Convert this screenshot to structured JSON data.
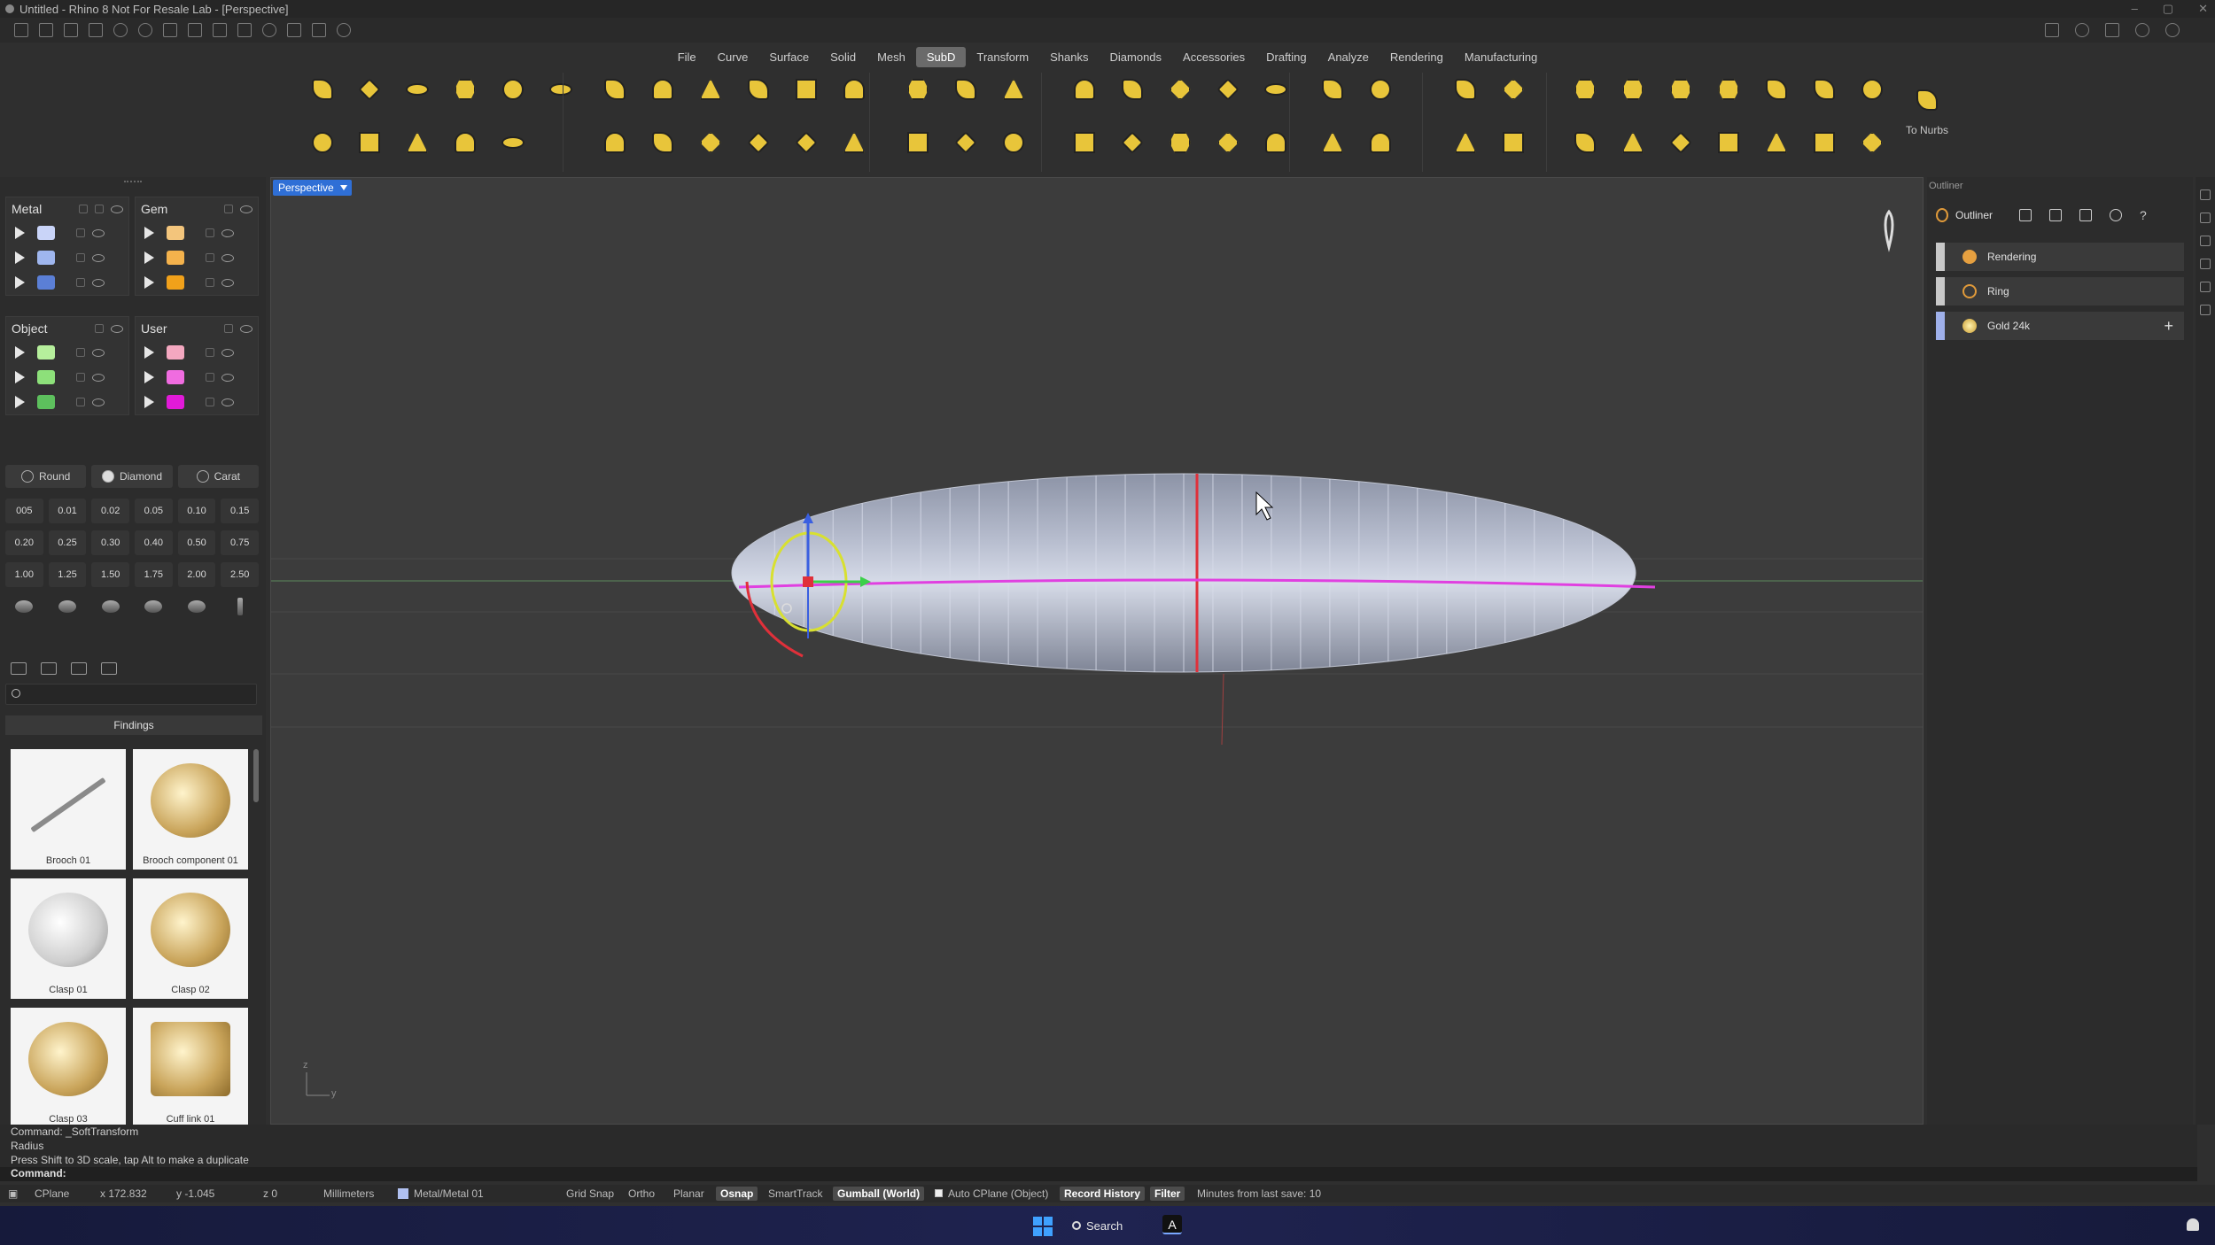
{
  "window": {
    "title": "Untitled - Rhino 8 Not For Resale Lab - [Perspective]"
  },
  "menu_tabs": [
    "File",
    "Curve",
    "Surface",
    "Solid",
    "Mesh",
    "SubD",
    "Transform",
    "Shanks",
    "Diamonds",
    "Accessories",
    "Drafting",
    "Analyze",
    "Rendering",
    "Manufacturing"
  ],
  "active_tab": "SubD",
  "toolbar": {
    "to_nurbs_label": "To Nurbs"
  },
  "layers": {
    "metal": {
      "title": "Metal",
      "colors": [
        "#c9d4f8",
        "#9fb6ee",
        "#5b7fd6"
      ]
    },
    "gem": {
      "title": "Gem",
      "colors": [
        "#f3c57c",
        "#f4b24c",
        "#f1a11a"
      ]
    },
    "object": {
      "title": "Object",
      "colors": [
        "#b6ef9c",
        "#8de07a",
        "#5dc05d"
      ]
    },
    "user": {
      "title": "User",
      "colors": [
        "#f4a8c0",
        "#f06ce0",
        "#e11ad8"
      ]
    }
  },
  "gem_panel": {
    "tabs": [
      "Round",
      "Diamond",
      "Carat"
    ],
    "sizes": [
      "005",
      "0.01",
      "0.02",
      "0.05",
      "0.10",
      "0.15",
      "0.20",
      "0.25",
      "0.30",
      "0.40",
      "0.50",
      "0.75",
      "1.00",
      "1.25",
      "1.50",
      "1.75",
      "2.00",
      "2.50"
    ]
  },
  "library": {
    "search_placeholder": "",
    "category": "Findings",
    "items": [
      "Brooch 01",
      "Brooch component 01",
      "Clasp 01",
      "Clasp 02",
      "Clasp 03",
      "Cuff link 01"
    ]
  },
  "viewport": {
    "name": "Perspective",
    "axis_z": "z",
    "axis_y": "y"
  },
  "outliner": {
    "panel_title": "Outliner",
    "header": "Outliner",
    "rows": [
      "Rendering",
      "Ring",
      "Gold 24k"
    ]
  },
  "command": {
    "lines": [
      "Command: _SoftTransform",
      "Radius",
      "Press Shift to 3D scale, tap Alt to make a duplicate"
    ],
    "prompt": "Command:"
  },
  "status": {
    "cplane": "CPlane",
    "x": "x 172.832",
    "y": "y -1.045",
    "z": "z 0",
    "units": "Millimeters",
    "layer": "Metal/Metal 01",
    "grid_snap": "Grid Snap",
    "ortho": "Ortho",
    "planar": "Planar",
    "osnap": "Osnap",
    "smarttrack": "SmartTrack",
    "gumball": "Gumball (World)",
    "auto_cplane": "Auto CPlane (Object)",
    "record_history": "Record History",
    "filter": "Filter",
    "last_save": "Minutes from last save: 10"
  },
  "taskbar": {
    "search_label": "Search"
  }
}
